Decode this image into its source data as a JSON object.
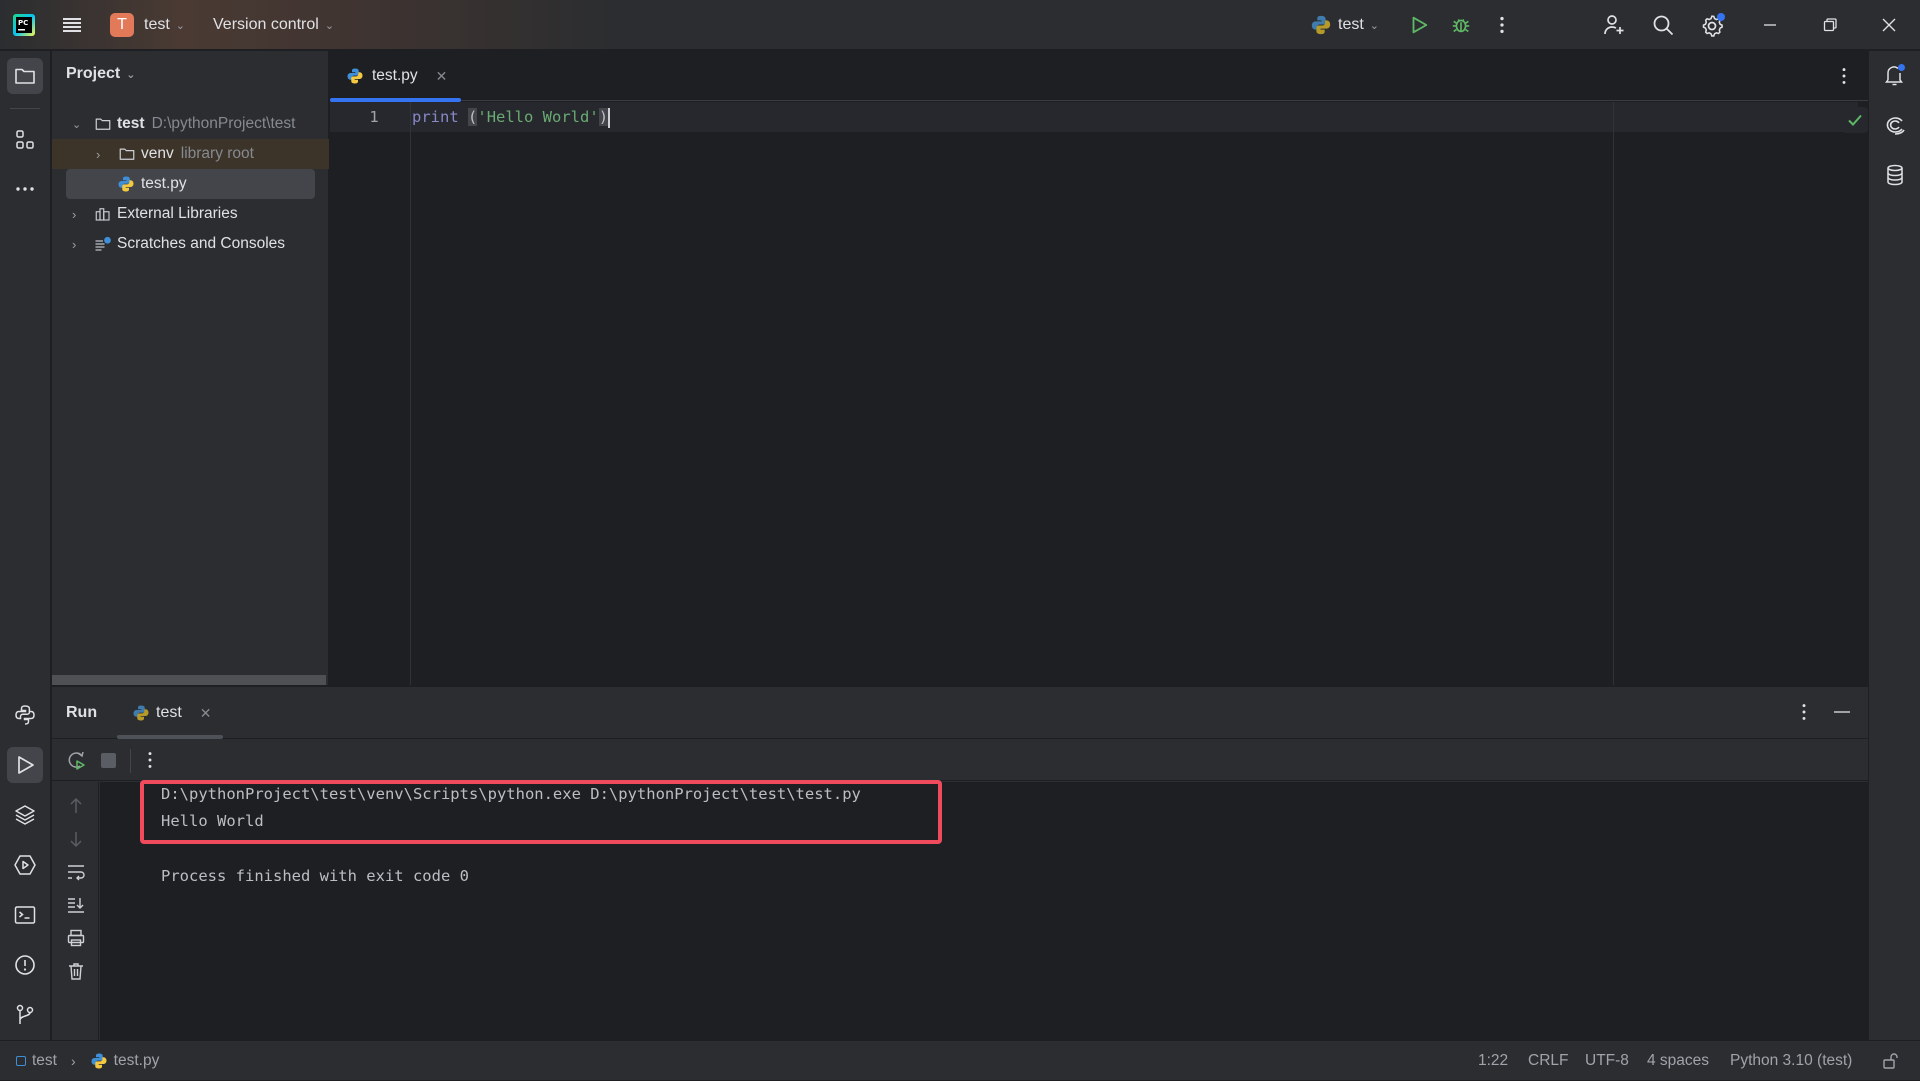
{
  "titlebar": {
    "project_initial": "T",
    "project_name": "test",
    "vcs_label": "Version control",
    "run_config": "test",
    "colors": {
      "run": "#5fb865",
      "debug": "#5fb865",
      "badge": "#e27a5a",
      "notification_dot": "#3574f0"
    }
  },
  "project_panel": {
    "title": "Project",
    "tree": [
      {
        "label": "test",
        "hint": "D:\\pythonProject\\test",
        "type": "folder",
        "expanded": true,
        "depth": 0
      },
      {
        "label": "venv",
        "hint": "library root",
        "type": "folder",
        "expanded": false,
        "depth": 1
      },
      {
        "label": "test.py",
        "hint": "",
        "type": "python-file",
        "selected": true,
        "depth": 1
      },
      {
        "label": "External Libraries",
        "hint": "",
        "type": "libraries",
        "expanded": false,
        "depth": 0
      },
      {
        "label": "Scratches and Consoles",
        "hint": "",
        "type": "scratches",
        "expanded": false,
        "depth": 0
      }
    ]
  },
  "editor": {
    "tab": {
      "label": "test.py",
      "active": true
    },
    "lines": [
      {
        "number": "1",
        "tokens": {
          "keyword": "print",
          "space": " ",
          "open_paren": "(",
          "string": "'Hello World'",
          "close_paren": ")"
        }
      }
    ],
    "inspection_status": "ok"
  },
  "run_panel": {
    "title": "Run",
    "tab_label": "test",
    "console": [
      "D:\\pythonProject\\test\\venv\\Scripts\\python.exe D:\\pythonProject\\test\\test.py",
      "Hello World",
      "",
      "Process finished with exit code 0"
    ],
    "highlight_color": "#ef4b5c"
  },
  "statusbar": {
    "breadcrumb": [
      "test",
      "test.py"
    ],
    "position": "1:22",
    "line_separator": "CRLF",
    "encoding": "UTF-8",
    "indent": "4 spaces",
    "interpreter": "Python 3.10 (test)"
  }
}
